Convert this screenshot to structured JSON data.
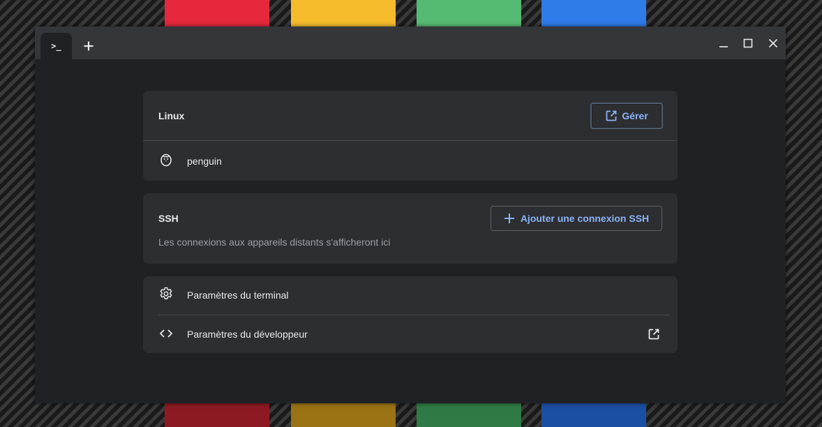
{
  "window": {
    "tab_label": ">_",
    "new_tab_symbol": "+"
  },
  "linux": {
    "title": "Linux",
    "manage_label": "Gérer",
    "container_name": "penguin"
  },
  "ssh": {
    "title": "SSH",
    "add_label": "Ajouter une connexion SSH",
    "empty_message": "Les connexions aux appareils distants s'afficheront ici"
  },
  "settings": {
    "terminal_label": "Paramètres du terminal",
    "developer_label": "Paramètres du développeur"
  },
  "colors": {
    "accent": "#8ab4f8",
    "background": "#202124",
    "card": "#2d2e31",
    "titlebar": "#35363a"
  },
  "icons": [
    "terminal-icon",
    "plus-icon",
    "minimize-icon",
    "maximize-icon",
    "close-icon",
    "open-external-icon",
    "penguin-icon",
    "gear-icon",
    "code-icon"
  ]
}
